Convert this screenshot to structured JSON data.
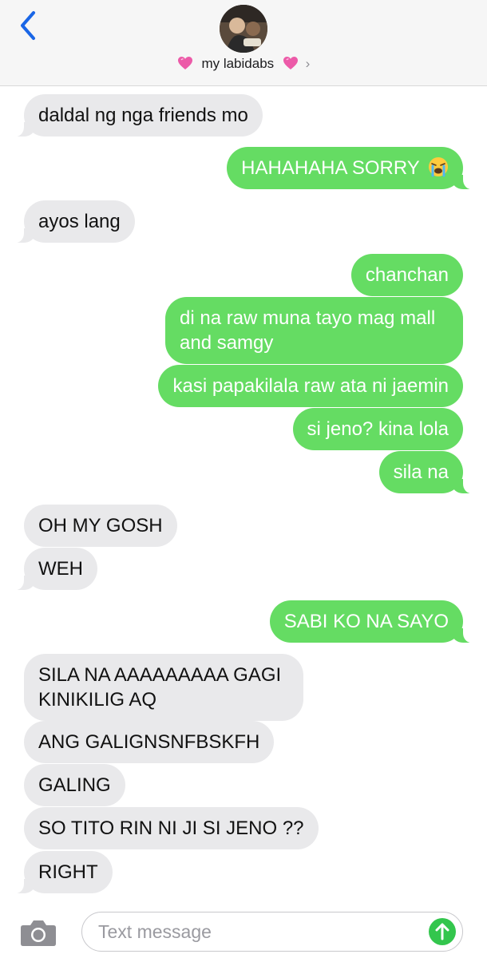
{
  "header": {
    "contact_name": "my labidabs",
    "chevron": "›",
    "icons": [
      "back-chevron-icon",
      "avatar",
      "pink-heart-icon",
      "chevron-right-icon"
    ]
  },
  "messages": [
    {
      "dir": "recv",
      "text": "daldal ng nga friends mo"
    },
    {
      "dir": "sent",
      "text": "HAHAHAHA SORRY",
      "emoji": "loudly-crying-face-icon"
    },
    {
      "dir": "recv",
      "text": "ayos lang"
    },
    {
      "dir": "sent",
      "text": "chanchan"
    },
    {
      "dir": "sent",
      "text": "di na raw muna tayo mag mall and samgy"
    },
    {
      "dir": "sent",
      "text": "kasi papakilala raw ata ni jaemin"
    },
    {
      "dir": "sent",
      "text": "si jeno? kina lola"
    },
    {
      "dir": "sent",
      "text": "sila na"
    },
    {
      "dir": "recv",
      "text": "OH MY GOSH"
    },
    {
      "dir": "recv",
      "text": "WEH"
    },
    {
      "dir": "sent",
      "text": "SABI KO NA SAYO"
    },
    {
      "dir": "recv",
      "text": "SILA NA AAAAAAAAA GAGI KINIKILIG AQ"
    },
    {
      "dir": "recv",
      "text": "ANG GALIGNSNFBSKFH"
    },
    {
      "dir": "recv",
      "text": "GALING"
    },
    {
      "dir": "recv",
      "text": "SO TITO RIN NI JI SI JENO ??"
    },
    {
      "dir": "recv",
      "text": "RIGHT"
    }
  ],
  "composer": {
    "placeholder": "Text message",
    "value": "",
    "icons": [
      "camera-icon",
      "send-arrow-icon"
    ]
  },
  "colors": {
    "sent_bubble": "#65dc63",
    "received_bubble": "#e9e9eb",
    "accent_blue": "#1a66e6",
    "send_button": "#33c64d"
  }
}
